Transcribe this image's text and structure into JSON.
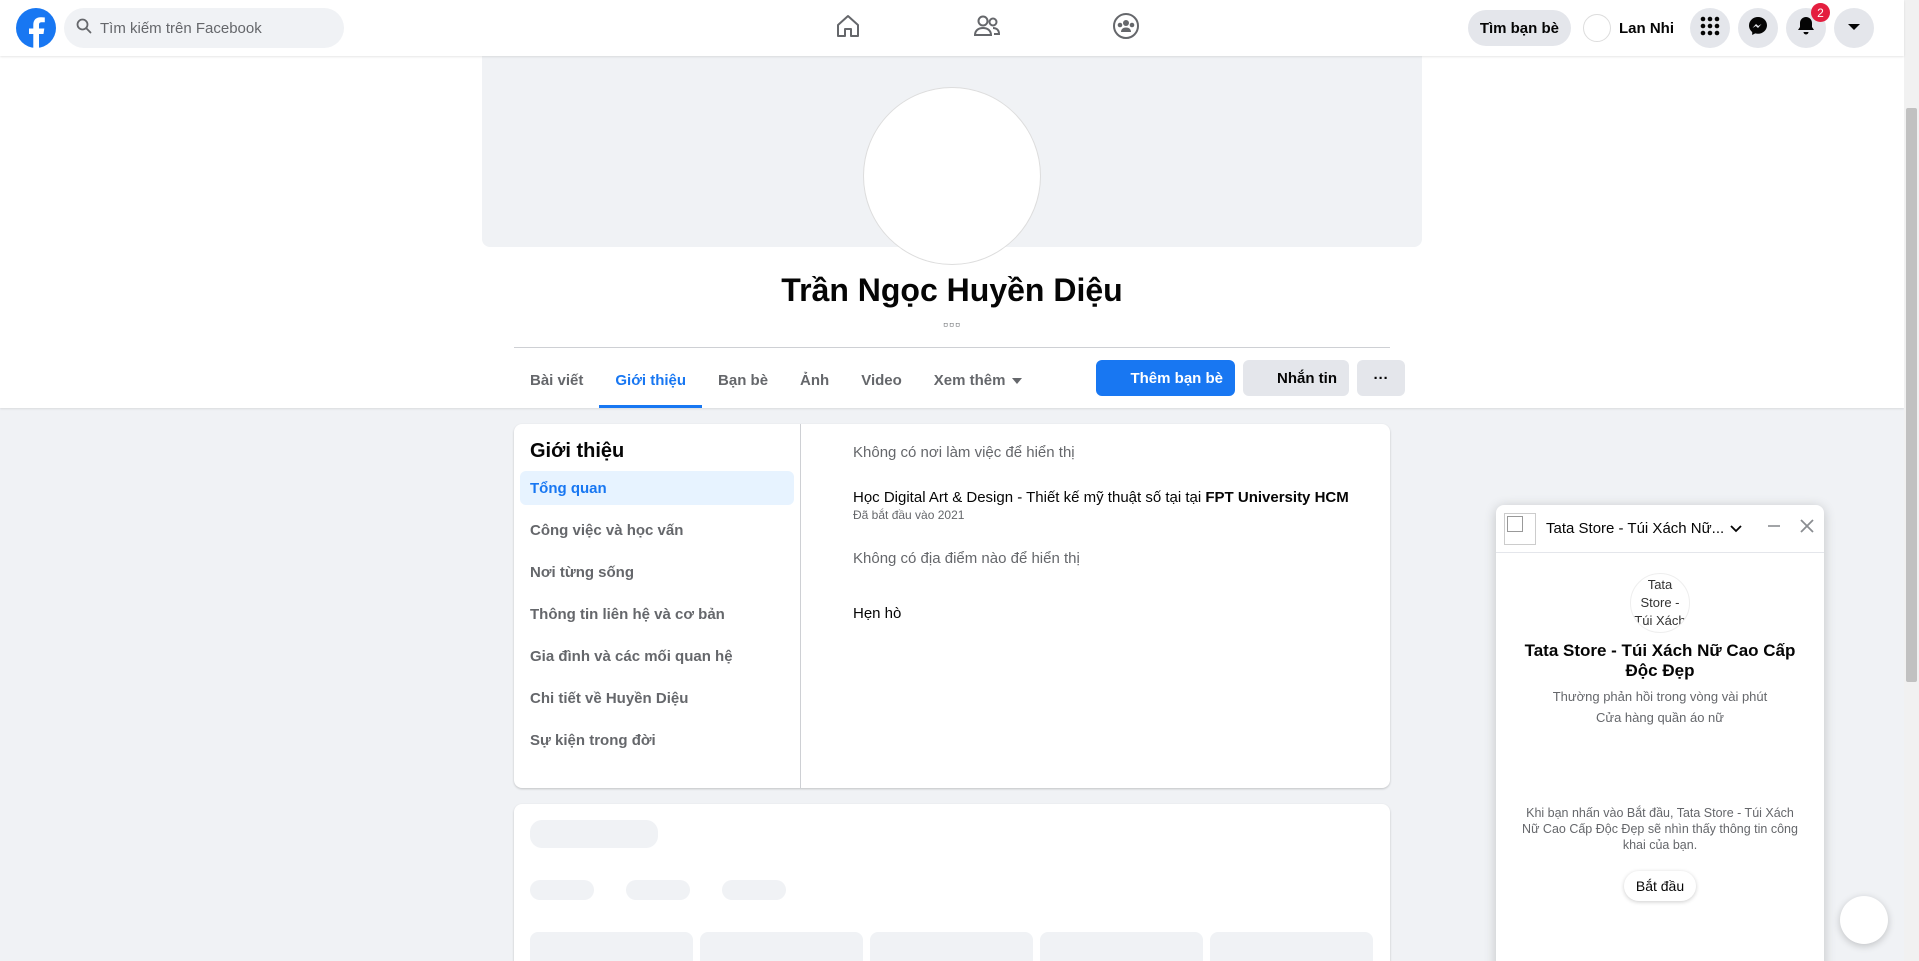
{
  "topbar": {
    "search_placeholder": "Tìm kiếm trên Facebook",
    "find_friends": "Tìm bạn bè",
    "user_name": "Lan Nhi",
    "notification_count": "2",
    "icons": [
      "facebook-logo-icon",
      "search-icon",
      "home-icon",
      "friends-icon",
      "groups-icon",
      "menu-grid-icon",
      "messenger-icon",
      "bell-icon",
      "caret-down-icon"
    ]
  },
  "profile": {
    "name": "Trần Ngọc Huyền Diệu",
    "subtitle": "▫▫▫"
  },
  "tabs": [
    {
      "label": "Bài viết"
    },
    {
      "label": "Giới thiệu"
    },
    {
      "label": "Bạn bè"
    },
    {
      "label": "Ảnh"
    },
    {
      "label": "Video"
    },
    {
      "label": "Xem thêm"
    }
  ],
  "actions": {
    "add_friend": "Thêm bạn bè",
    "message": "Nhắn tin",
    "more": "···"
  },
  "about": {
    "title": "Giới thiệu",
    "menu": [
      "Tổng quan",
      "Công việc và học vấn",
      "Nơi từng sống",
      "Thông tin liên hệ và cơ bản",
      "Gia đình và các mối quan hệ",
      "Chi tiết về Huyền Diệu",
      "Sự kiện trong đời"
    ],
    "work": "Không có nơi làm việc để hiển thị",
    "education_prefix": "Học Digital Art & Design - Thiết kế mỹ thuật số tại tại ",
    "education_school": "FPT University HCM",
    "education_since": "Đã bắt đầu vào 2021",
    "places": "Không có địa điểm nào để hiển thị",
    "dating": "Hẹn hò"
  },
  "chat": {
    "title": "Tata Store - Túi Xách Nữ...",
    "avatar_alt": "Tata Store - Túi Xách",
    "page_name": "Tata Store - Túi Xách Nữ Cao Cấp Độc Đẹp",
    "response": "Thường phản hồi trong vòng vài phút",
    "category": "Cửa hàng quần áo nữ",
    "consent": "Khi bạn nhấn vào Bắt đầu, Tata Store - Túi Xách Nữ Cao Cấp Độc Đẹp sẽ nhìn thấy thông tin công khai của bạn.",
    "start": "Bắt đầu"
  },
  "colors": {
    "brand": "#1877f2",
    "badge": "#e41e3f"
  }
}
